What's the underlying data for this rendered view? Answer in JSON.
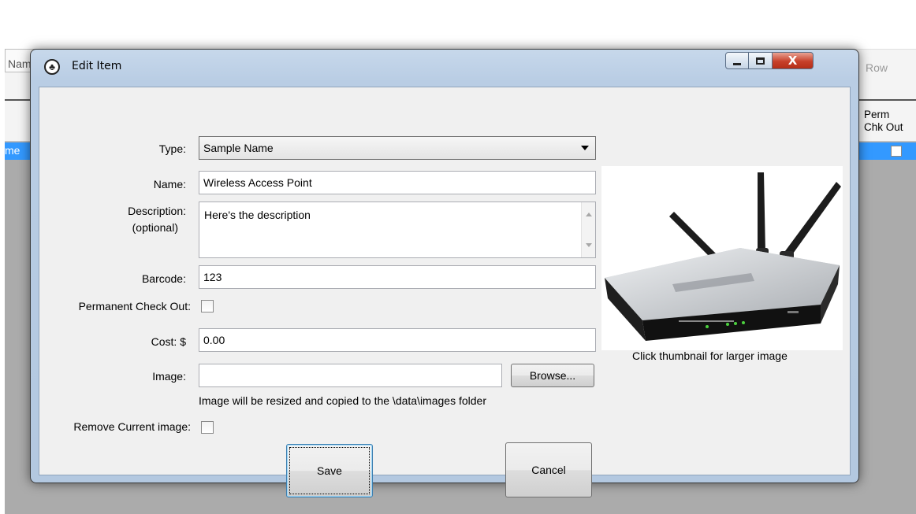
{
  "background": {
    "name_header_fragment": "Nam",
    "row_button_fragment": "Row",
    "selected_row_fragment": "me",
    "perm_header_line1": "Perm",
    "perm_header_line2": "Chk Out"
  },
  "dialog": {
    "title": "Edit Item",
    "close_glyph": "X",
    "form": {
      "type_label": "Type:",
      "type_value": "Sample Name",
      "name_label": "Name:",
      "name_value": "Wireless Access Point",
      "description_label": "Description:",
      "description_optional": "(optional)",
      "description_value": "Here's the description",
      "barcode_label": "Barcode:",
      "barcode_value": "123",
      "permanent_checkout_label": "Permanent Check Out:",
      "permanent_checkout_checked": false,
      "cost_label": "Cost: $",
      "cost_value": "0.00",
      "image_label": "Image:",
      "image_value": "",
      "browse_label": "Browse...",
      "image_note": "Image will be resized and copied to the \\data\\images folder",
      "remove_image_label": "Remove Current image:",
      "remove_image_checked": false
    },
    "thumbnail_hint": "Click thumbnail for larger image",
    "buttons": {
      "save": "Save",
      "cancel": "Cancel"
    }
  },
  "colors": {
    "selection": "#3399ff",
    "close_button": "#c7402a",
    "window_frame": "#b9cde4"
  }
}
